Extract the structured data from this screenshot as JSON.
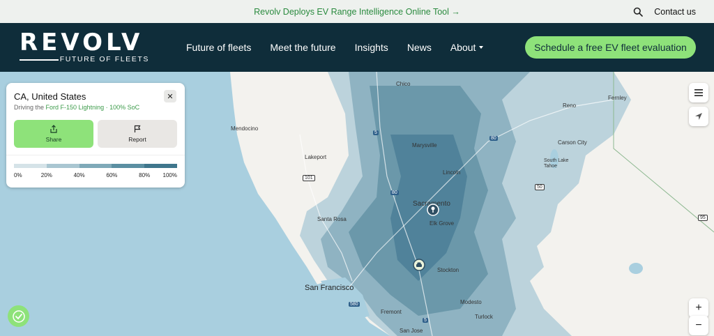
{
  "announcement": {
    "text": "Revolv Deploys EV Range Intelligence Online Tool →"
  },
  "topbar": {
    "contact": "Contact us",
    "search_icon": "search-icon"
  },
  "brand": {
    "word": "REVOLV",
    "tagline": "FUTURE OF FLEETS"
  },
  "nav": {
    "items": [
      {
        "label": "Future of fleets"
      },
      {
        "label": "Meet the future"
      },
      {
        "label": "Insights"
      },
      {
        "label": "News"
      },
      {
        "label": "About"
      }
    ],
    "cta": "Schedule a free EV fleet evaluation"
  },
  "card": {
    "location": "CA, United States",
    "subtitle_prefix": "Driving the ",
    "vehicle": "Ford F-150 Lightning",
    "separator": " · ",
    "soc": "100% SoC",
    "close": "✕",
    "share_label": "Share",
    "report_label": "Report",
    "scale_colors": [
      "#d5e3e8",
      "#a9c6d1",
      "#7fa9b8",
      "#5b8fa2",
      "#3f768c"
    ],
    "scale_ticks": [
      "0%",
      "20%",
      "40%",
      "60%",
      "80%",
      "100%"
    ]
  },
  "map": {
    "labels": {
      "chico": "Chico",
      "reno": "Reno",
      "fernley": "Fernley",
      "mendocino": "Mendocino",
      "marysville": "Marysville",
      "carson_city": "Carson City",
      "south_lake_tahoe": "South Lake Tahoe",
      "lakeport": "Lakeport",
      "lincoln": "Lincoln",
      "sacramento": "Sacramento",
      "santa_rosa": "Santa Rosa",
      "elk_grove": "Elk Grove",
      "stockton": "Stockton",
      "san_francisco": "San Francisco",
      "fremont": "Fremont",
      "modesto": "Modesto",
      "turlock": "Turlock",
      "san_jose": "San Jose"
    },
    "shields": {
      "i5": "5",
      "i80a": "80",
      "i80b": "80",
      "us101": "101",
      "us50": "50",
      "us95": "95",
      "i580": "580",
      "i5b": "5"
    },
    "controls": {
      "zoom_in": "+",
      "zoom_out": "−"
    }
  },
  "colors": {
    "nav_bg": "#0f2d3a",
    "accent": "#8ee27a",
    "water": "#a9cfdf",
    "land": "#f3f2ee"
  }
}
